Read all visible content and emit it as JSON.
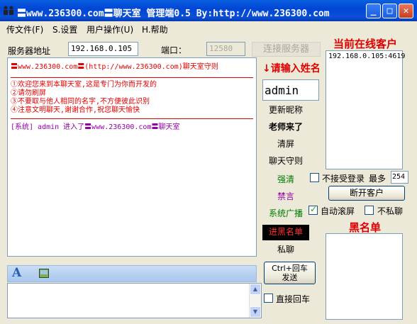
{
  "window": {
    "title": "〓www.236300.com〓聊天室 管理端0.5  By:http://www.236300.com",
    "minimize": "_",
    "maximize": "□",
    "close": "✕"
  },
  "menu": {
    "file": "传文件(F)",
    "settings": "S.设置",
    "user_ops": "用户操作(U)",
    "help": "H.帮助"
  },
  "connection": {
    "server_label": "服务器地址",
    "server_value": "192.168.0.105",
    "port_label": "端口：",
    "port_value": "12580",
    "connect_button": "连接服务器"
  },
  "chat": {
    "header": "〓www.236300.com〓(http://www.236300.com)聊天室守则",
    "rules": [
      "①欢迎您来到本聊天室,这是专门为你而开发的",
      "②请勿刷屏",
      "③不要取与他人相同的名字,不方便彼此识别",
      "④注意文明聊天,谢谢合作,祝您聊天愉快"
    ],
    "system_msg": "[系统] admin 进入了〓www.236300.com〓聊天室"
  },
  "name_panel": {
    "prompt": "↓请输入姓名",
    "name_value": "admin",
    "buttons": [
      "更新昵称",
      "老师来了",
      "清屏",
      "聊天守则",
      "强清",
      "禁言",
      "系统广播",
      "进黑名单",
      "私聊"
    ],
    "send_button": "Ctrl+回车\n发送",
    "direct_enter": "直接回车"
  },
  "online": {
    "title": "当前在线客户",
    "clients": [
      "192.168.0.105:4619"
    ],
    "reject_login": "不接受登录",
    "max_label": "最多",
    "max_value": "254",
    "disconnect_button": "断开客户",
    "auto_scroll": "自动滚屏",
    "no_private": "不私聊"
  },
  "blacklist": {
    "title": "黑名单"
  },
  "colors": {
    "accent_red": "#e00000",
    "titlebar_blue": "#0046d5",
    "green_text": "#007a00",
    "purple_text": "#9400a8"
  }
}
